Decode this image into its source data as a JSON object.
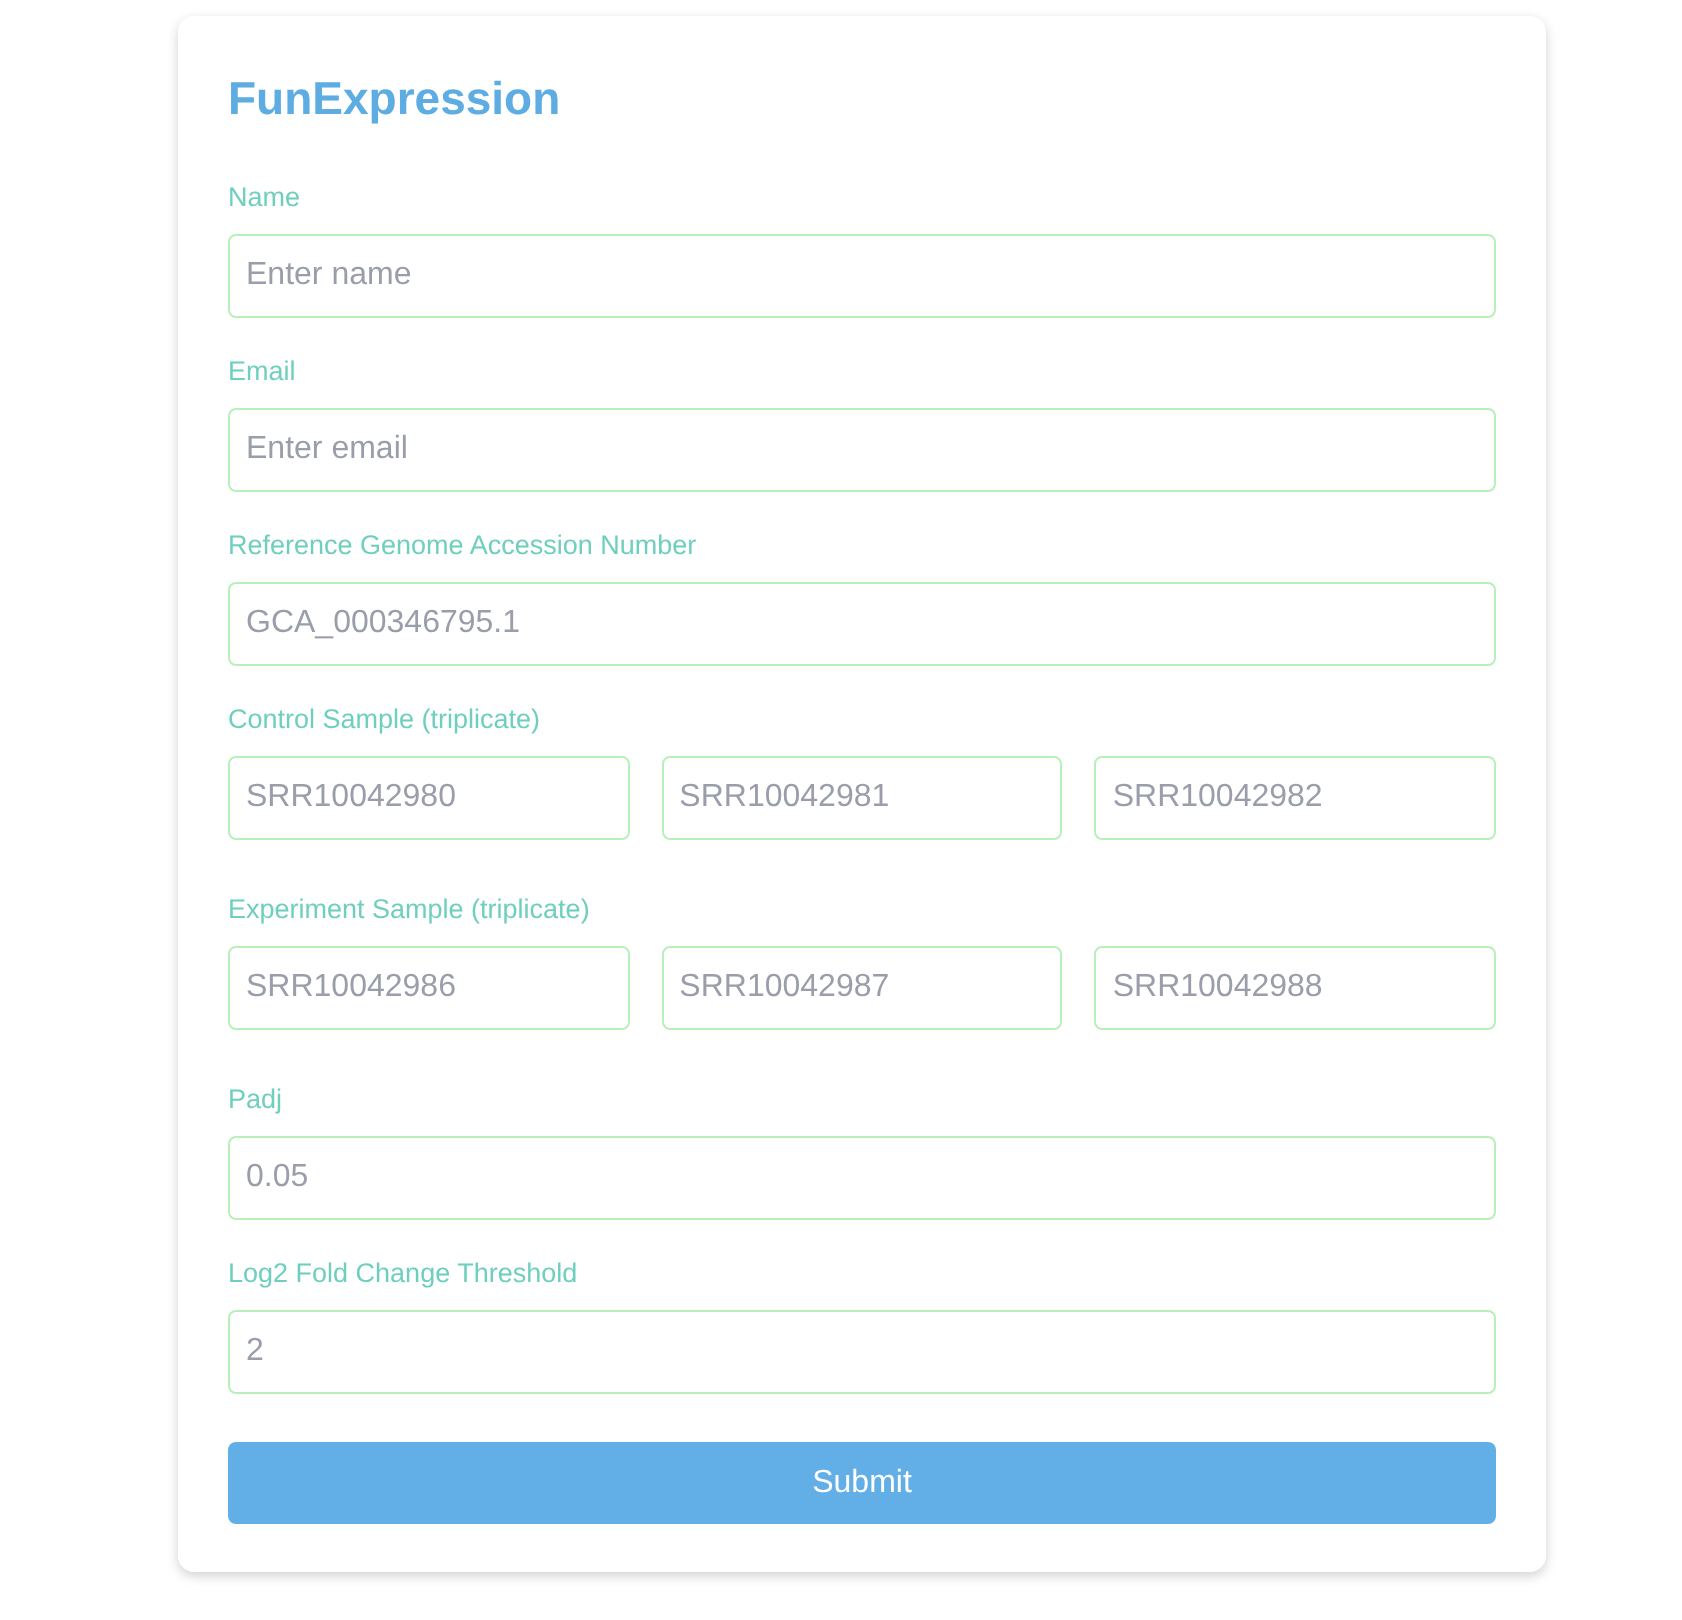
{
  "title": "FunExpression",
  "fields": [
    {
      "kind": "single",
      "label": "Name",
      "inputs": [
        {
          "placeholder": "Enter name"
        }
      ]
    },
    {
      "kind": "single",
      "label": "Email",
      "inputs": [
        {
          "placeholder": "Enter email"
        }
      ]
    },
    {
      "kind": "single",
      "label": "Reference Genome Accession Number",
      "inputs": [
        {
          "placeholder": "GCA_000346795.1"
        }
      ]
    },
    {
      "kind": "triple",
      "label": "Control Sample (triplicate)",
      "inputs": [
        {
          "placeholder": "SRR10042980"
        },
        {
          "placeholder": "SRR10042981"
        },
        {
          "placeholder": "SRR10042982"
        }
      ]
    },
    {
      "kind": "triple",
      "label": "Experiment Sample (triplicate)",
      "inputs": [
        {
          "placeholder": "SRR10042986"
        },
        {
          "placeholder": "SRR10042987"
        },
        {
          "placeholder": "SRR10042988"
        }
      ]
    },
    {
      "kind": "single",
      "label": "Padj",
      "inputs": [
        {
          "placeholder": "0.05"
        }
      ]
    },
    {
      "kind": "single",
      "label": "Log2 Fold Change Threshold",
      "inputs": [
        {
          "placeholder": "2"
        }
      ]
    }
  ],
  "submit": "Submit"
}
